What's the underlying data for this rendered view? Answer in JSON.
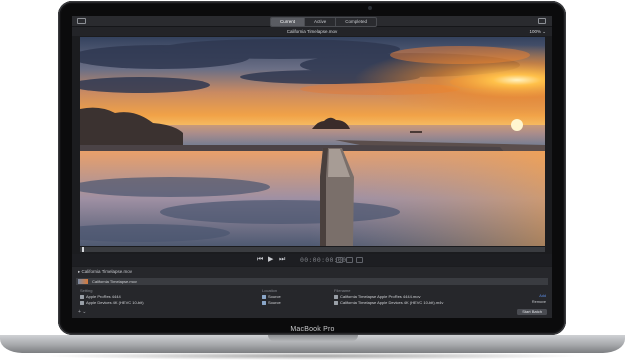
{
  "device": {
    "brand_label": "MacBook Pro"
  },
  "app": {
    "tabs": [
      {
        "label": "Current",
        "active": true
      },
      {
        "label": "Active",
        "active": false
      },
      {
        "label": "Completed",
        "active": false
      }
    ],
    "document_title": "California Timelapse.mov",
    "zoom": "100%",
    "transport": {
      "timecode": "00:00:00:00",
      "prev_symbol": "⏮",
      "play_symbol": "▶",
      "next_symbol": "⏭"
    },
    "batch": {
      "source_file": "California Timelapse.mov",
      "job_name": "California Timelapse.mov",
      "columns": {
        "setting": "Setting",
        "location": "Location",
        "filename": "Filename"
      },
      "outputs": [
        {
          "setting": "Apple ProRes 4444",
          "location": "Source",
          "filename": "California Timelapse Apple ProRes 4444.mov",
          "action": "Add"
        },
        {
          "setting": "Apple Devices 4K (HEVC 10-bit)",
          "location": "Source",
          "filename": "California Timelapse Apple Devices 4K (HEVC 10-bit).m4v",
          "action": "Remove"
        }
      ],
      "add_symbol": "+ ⌄",
      "start_button": "Start Batch"
    },
    "colors": {
      "accent": "#5a5c62",
      "sky_top": "#3b4a66",
      "sunset": "#f08a2a"
    }
  }
}
